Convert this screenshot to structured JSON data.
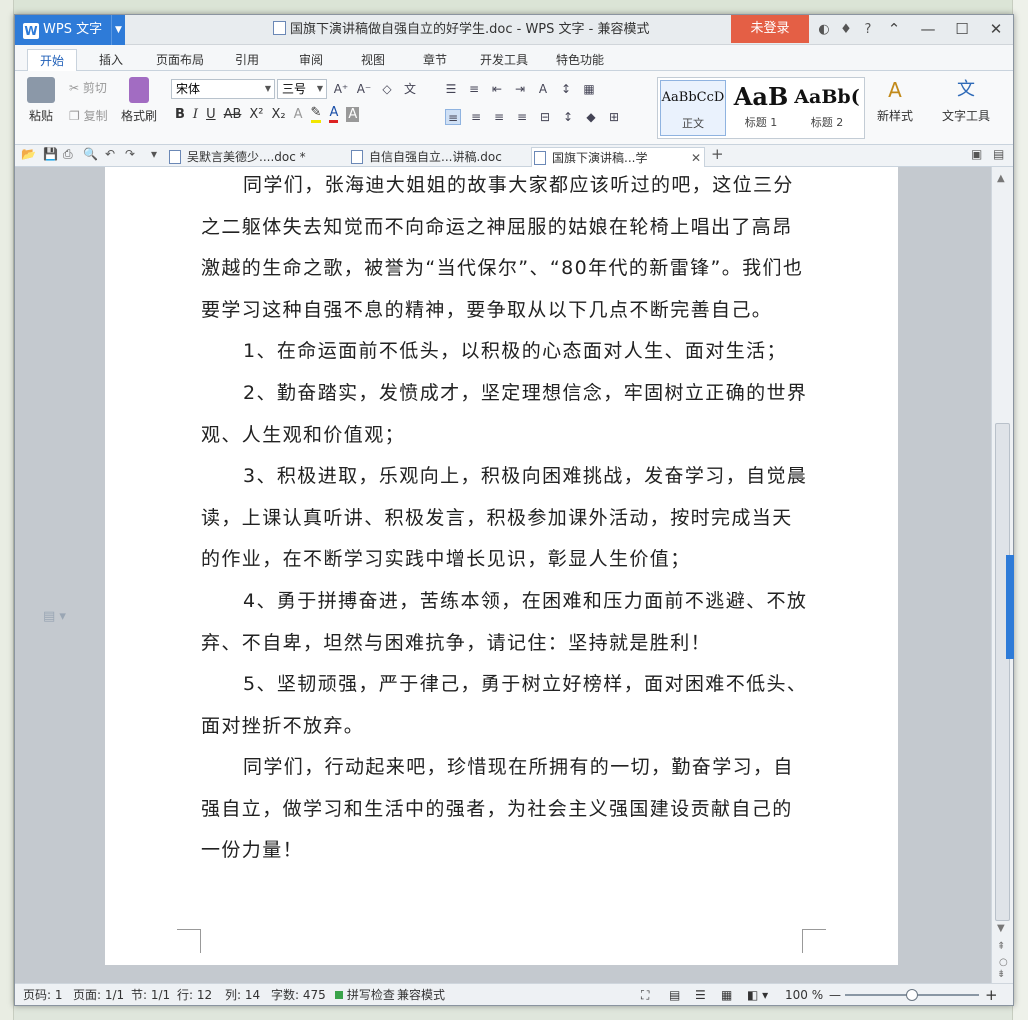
{
  "app": {
    "name": "WPS 文字",
    "window_title": "国旗下演讲稿做自强自立的好学生.doc - WPS 文字 - 兼容模式",
    "login_label": "未登录"
  },
  "ribbon_tabs": [
    "开始",
    "插入",
    "页面布局",
    "引用",
    "审阅",
    "视图",
    "章节",
    "开发工具",
    "特色功能"
  ],
  "ribbon": {
    "paste": "粘贴",
    "cut": "剪切",
    "copy": "复制",
    "format_painter": "格式刷",
    "font_name": "宋体",
    "font_size": "三号",
    "styles": [
      {
        "preview": "AaBbCcD",
        "label": "正文"
      },
      {
        "preview": "AaB",
        "label": "标题 1"
      },
      {
        "preview": "AaBb(",
        "label": "标题 2"
      }
    ],
    "new_style": "新样式",
    "text_tools": "文字工具"
  },
  "doc_tabs": [
    {
      "label": "吴默言美德少....doc *"
    },
    {
      "label": "自信自强自立...讲稿.doc"
    },
    {
      "label": "国旗下演讲稿...学生.doc"
    }
  ],
  "document": {
    "paragraphs": [
      "同学们，张海迪大姐姐的故事大家都应该听过的吧，这位三分之二躯体失去知觉而不向命运之神屈服的姑娘在轮椅上唱出了高昂激越的生命之歌，被誉为“当代保尔”、“80年代的新雷锋”。我们也要学习这种自强不息的精神，要争取从以下几点不断完善自己。",
      "1、在命运面前不低头，以积极的心态面对人生、面对生活；",
      "2、勤奋踏实，发愤成才，坚定理想信念，牢固树立正确的世界观、人生观和价值观；",
      "3、积极进取，乐观向上，积极向困难挑战，发奋学习，自觉晨读，上课认真听讲、积极发言，积极参加课外活动，按时完成当天的作业，在不断学习实践中增长见识，彰显人生价值；",
      "4、勇于拼搏奋进，苦练本领，在困难和压力面前不逃避、不放弃、不自卑，坦然与困难抗争，请记住：坚持就是胜利！",
      "5、坚韧顽强，严于律己，勇于树立好榜样，面对困难不低头、面对挫折不放弃。",
      "同学们，行动起来吧，珍惜现在所拥有的一切，勤奋学习，自强自立，做学习和生活中的强者，为社会主义强国建设贡献自己的一份力量！"
    ]
  },
  "status": {
    "page_code": "页码: 1",
    "pages": "页面: 1/1",
    "section": "节: 1/1",
    "row": "行: 12",
    "col": "列: 14",
    "word_count": "字数: 475",
    "spell_check": "拼写检查",
    "compat_mode": "兼容模式",
    "zoom": "100 %",
    "zoom_fraction": 0.5
  }
}
